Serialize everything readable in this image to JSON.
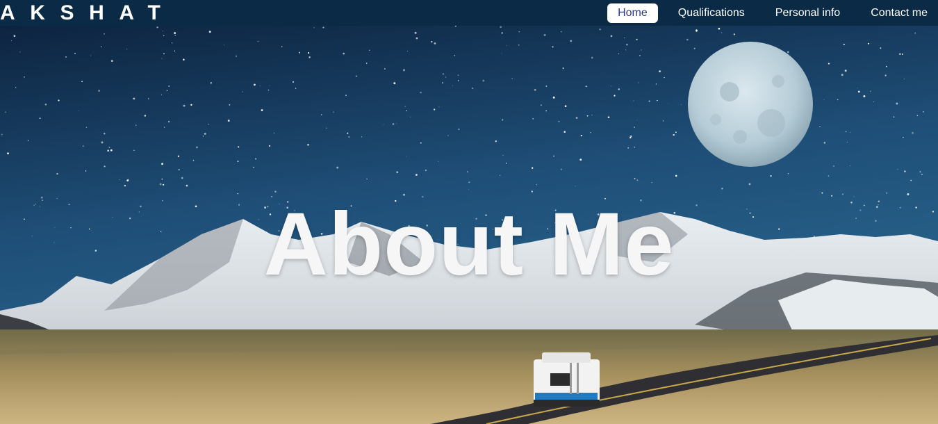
{
  "brand": {
    "name": "AKSHAT"
  },
  "nav": {
    "items": [
      {
        "label": "Home",
        "active": true
      },
      {
        "label": "Qualifications",
        "active": false
      },
      {
        "label": "Personal info",
        "active": false
      },
      {
        "label": "Contact me",
        "active": false
      }
    ]
  },
  "hero": {
    "title": "About Me",
    "image_description_icons": [
      "starry-sky",
      "full-moon",
      "snowy-mountains",
      "grass-field",
      "road",
      "camper-van"
    ]
  },
  "colors": {
    "nav_bg": "#0a2a45",
    "sky_top": "#0d2440",
    "sky_mid": "#1f4f78",
    "active_tab_text": "#2a3b8f",
    "title": "#f6f6f6"
  }
}
